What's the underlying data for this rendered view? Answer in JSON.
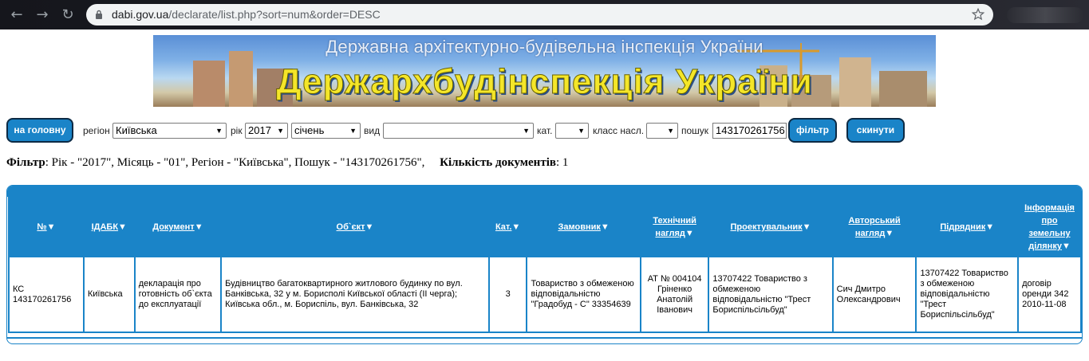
{
  "browser": {
    "back_icon": "back-arrow-icon",
    "forward_icon": "forward-arrow-icon",
    "reload_icon": "reload-icon",
    "url_host": "dabi.gov.ua",
    "url_path": "/declarate/list.php?sort=num&order=DESC"
  },
  "banner": {
    "subtitle": "Державна архітектурно-будівельна інспекція України",
    "title": "Держархбудінспекція України"
  },
  "form": {
    "home_button": "на головну",
    "region_label": "регіон",
    "region_value": "Київська",
    "year_label": "рік",
    "year_value": "2017",
    "month_value": "січень",
    "type_label": "вид",
    "type_value": "",
    "cat_label": "кат.",
    "cat_value": "",
    "class_label": "класс насл.",
    "class_value": "",
    "search_label": "пошук",
    "search_value": "143170261756",
    "filter_button": "фільтр",
    "reset_button": "скинути"
  },
  "summary": {
    "filter_label": "Фільтр",
    "filter_text": ": Рік - \"2017\", Місяць - \"01\", Регіон - \"Київська\", Пошук - \"143170261756\",",
    "count_label": "Кількість документів",
    "count_value": ": 1"
  },
  "table": {
    "headers": [
      "№",
      "ІДАБК",
      "Документ",
      "Об`єкт",
      "Кат.",
      "Замовник",
      "Технічний нагляд",
      "Проектувальник",
      "Авторський нагляд",
      "Підрядник",
      "Інформація про земельну ділянку"
    ],
    "rows": [
      [
        "КС 143170261756",
        "Київська",
        "декларація про готовність об`єкта до експлуатації",
        "Будівництво багатоквартирного житлового будинку по вул. Банківська, 32 у м. Борисполі Київської області (ІІ черга); Київська обл., м. Бориспіль, вул. Банківська, 32",
        "3",
        "Товариство з обмеженою відповідальністю \"Градобуд - С\" 33354639",
        "АТ № 004104 Гріненко Анатолій Іванович",
        "13707422 Товариство з обмеженою відповідальністю \"Трест Бориспільсільбуд\"",
        "Сич Дмитро Олександрович",
        "13707422 Товариство з обмеженою відповідальністю \"Трест Бориспільсільбуд\"",
        "договір оренди 342 2010-11-08"
      ]
    ]
  },
  "colors": {
    "accent": "#1a84c8",
    "banner_title": "#f4e629"
  }
}
